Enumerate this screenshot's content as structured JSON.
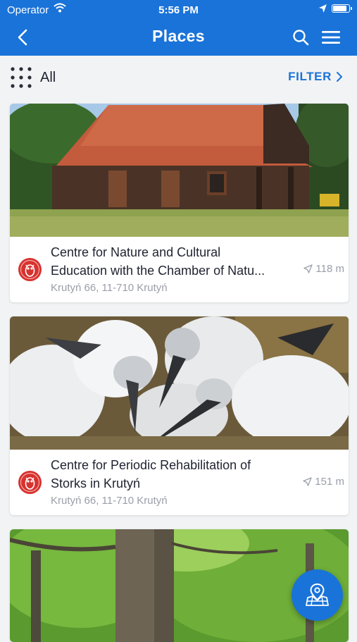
{
  "status_bar": {
    "carrier": "Operator",
    "time": "5:56 PM"
  },
  "header": {
    "title": "Places"
  },
  "filter_bar": {
    "category_label": "All",
    "filter_label": "FILTER"
  },
  "places": [
    {
      "name_line1": "Centre for Nature and Cultural",
      "name_line2": "Education with the Chamber of Natu...",
      "address": "Krutyń 66, 11-710 Krutyń",
      "distance": "118 m",
      "photo": "wooden-barn-photo"
    },
    {
      "name_line1": "Centre for Periodic Rehabilitation of",
      "name_line2": "Storks in Krutyń",
      "address": "Krutyń 66, 11-710 Krutyń",
      "distance": "151 m",
      "photo": "stork-chicks-photo"
    },
    {
      "photo": "forest-trees-photo"
    }
  ],
  "colors": {
    "accent": "#1a73d8",
    "badge": "#d8322e",
    "muted_text": "#9a9ea8"
  },
  "icons": [
    "back-arrow-icon",
    "search-icon",
    "menu-icon",
    "grid-dots-icon",
    "chevron-right-icon",
    "owl-icon",
    "navigation-arrow-icon",
    "map-pin-icon"
  ]
}
